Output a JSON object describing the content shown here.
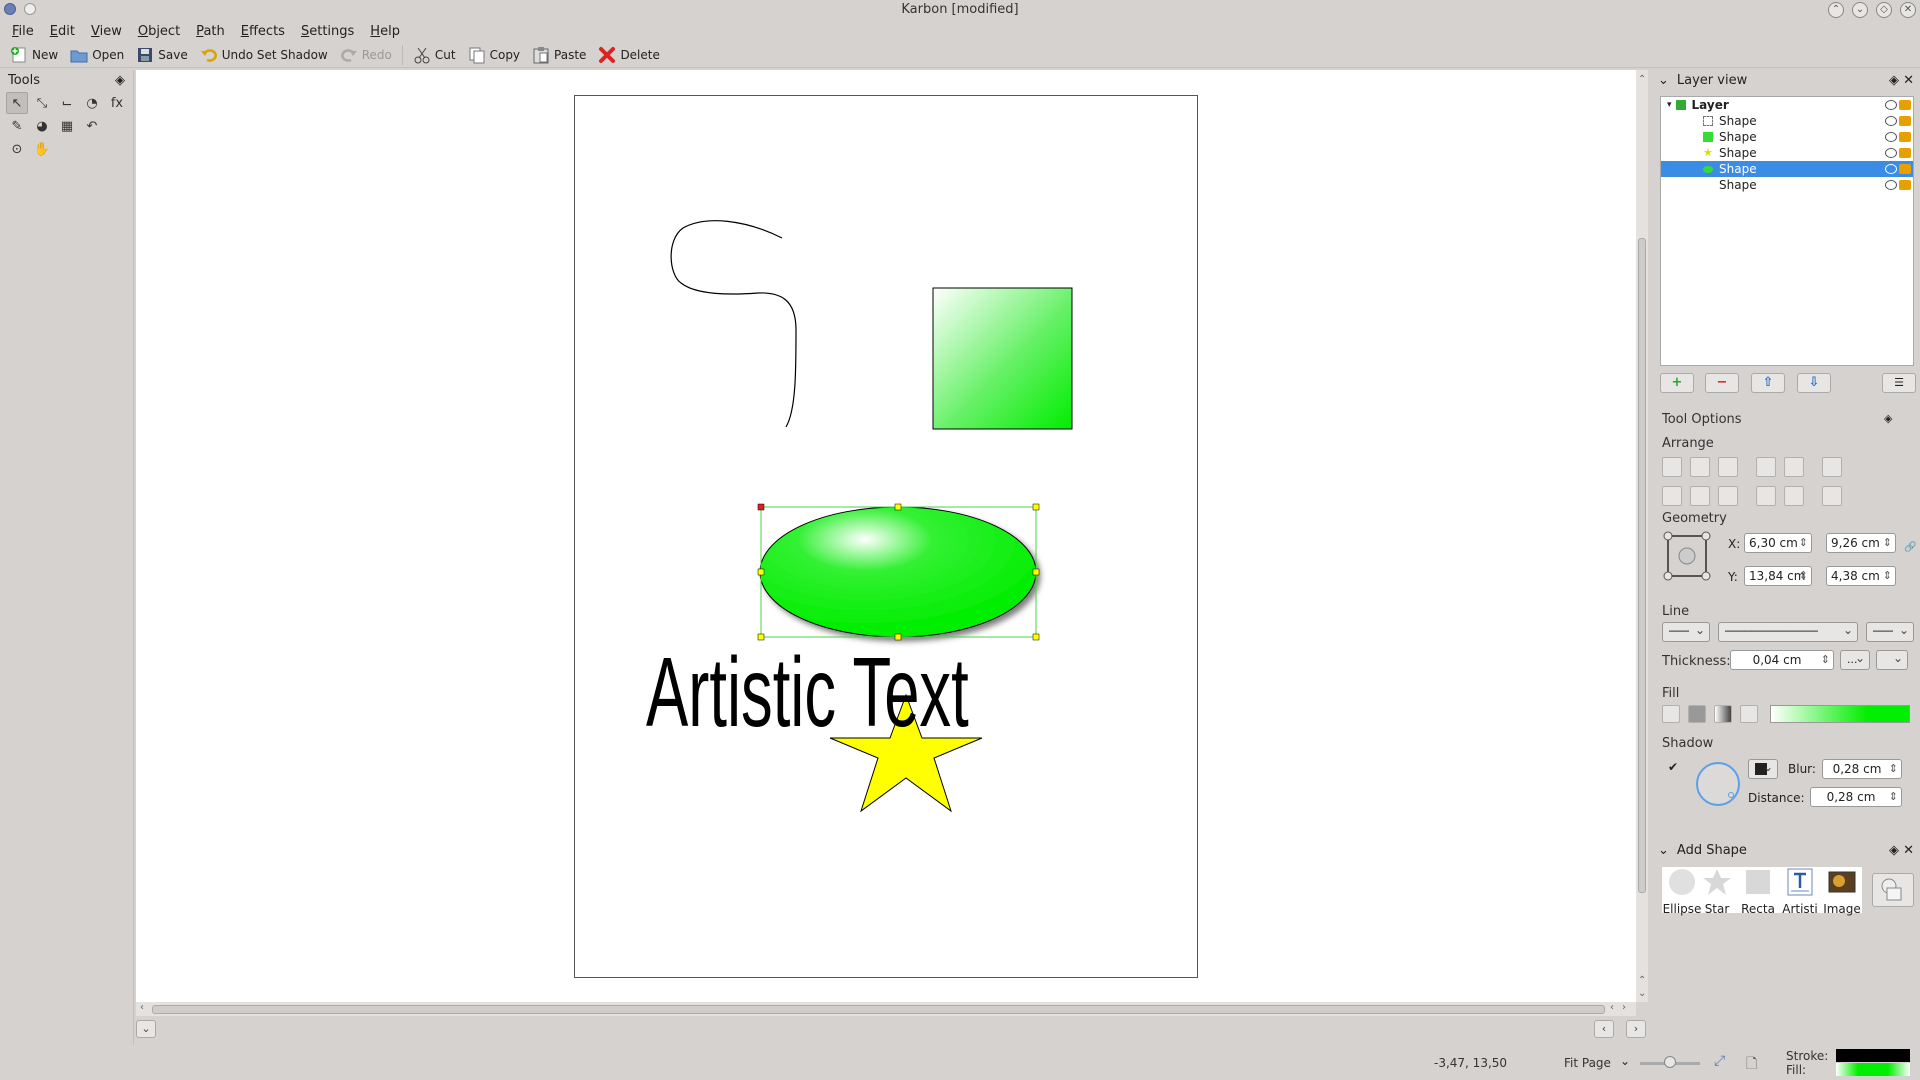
{
  "window": {
    "title": "Karbon [modified]"
  },
  "menu": [
    "File",
    "Edit",
    "View",
    "Object",
    "Path",
    "Effects",
    "Settings",
    "Help"
  ],
  "toolbar": {
    "new": "New",
    "open": "Open",
    "save": "Save",
    "undo": "Undo Set Shadow",
    "redo": "Redo",
    "cut": "Cut",
    "copy": "Copy",
    "paste": "Paste",
    "delete": "Delete"
  },
  "tools_panel": {
    "title": "Tools"
  },
  "canvas": {
    "artistic_text": "Artistic Text"
  },
  "layer_view": {
    "title": "Layer view",
    "layer_name": "Layer",
    "shapes": [
      "Shape",
      "Shape",
      "Shape",
      "Shape",
      "Shape"
    ],
    "selected_index": 3
  },
  "tool_options": {
    "title": "Tool Options",
    "arrange_label": "Arrange",
    "geometry_label": "Geometry",
    "x_label": "X:",
    "y_label": "Y:",
    "x_value": "6,30 cm",
    "y_value": "13,84 cm",
    "width_value": "9,26 cm",
    "height_value": "4,38 cm",
    "line_label": "Line",
    "thickness_label": "Thickness:",
    "thickness_value": "0,04 cm",
    "thickness_more": "...",
    "fill_label": "Fill",
    "shadow_label": "Shadow",
    "blur_label": "Blur:",
    "blur_value": "0,28 cm",
    "distance_label": "Distance:",
    "distance_value": "0,28 cm"
  },
  "add_shape": {
    "title": "Add Shape",
    "items": [
      "Ellipse",
      "Star",
      "Recta",
      "Artisti",
      "Image"
    ]
  },
  "status": {
    "coords": "-3,47, 13,50",
    "zoom": "Fit Page",
    "stroke_label": "Stroke:",
    "fill_label": "Fill:"
  },
  "colors": {
    "accent": "#3b8ce5",
    "fill_green": "#00ee00",
    "star_yellow": "#ffff00"
  }
}
